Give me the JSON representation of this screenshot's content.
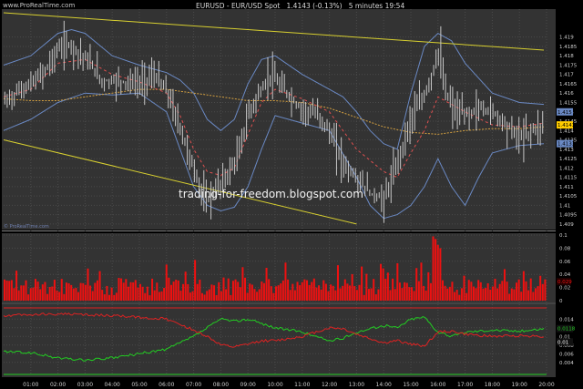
{
  "header": {
    "brand": "www.ProRealTime.com",
    "symbol": "EURUSD - EUR/USD Spot",
    "price": "1.4143 (-0.13%)",
    "timeframe": "5 minutes",
    "time": "19:54"
  },
  "watermark": "trading-for-freedom.blogspot.com",
  "panel_logo": "© ProRealTime.com",
  "colors": {
    "background": "#000000",
    "panel": "#333333",
    "candles": "#c8c8c8",
    "bollinger": "#6a89c4",
    "ma_short": "#e05050",
    "ma_long": "#d4a040",
    "trendline": "#d8d030",
    "volume_bars": "#ee1111",
    "ind_green": "#22cc22",
    "ind_red": "#dd2222"
  },
  "chart_data": [
    {
      "type": "line",
      "title": "EURUSD - EUR/USD Spot",
      "ylim": [
        1.4088,
        1.4203
      ],
      "yticks": [
        "1.419",
        "1.4185",
        "1.418",
        "1.4175",
        "1.417",
        "1.4165",
        "1.416",
        "1.4155",
        "1.415",
        "1.4145",
        "1.414",
        "1.4135",
        "1.413",
        "1.4125",
        "1.412",
        "1.4115",
        "1.411",
        "1.4105",
        "1.41",
        "1.4095",
        "1.409"
      ],
      "xticks": [
        "01:00",
        "02:00",
        "03:00",
        "04:00",
        "05:00",
        "06:00",
        "07:00",
        "08:00",
        "09:00",
        "10:00",
        "11:00",
        "12:00",
        "13:00",
        "14:00",
        "15:00",
        "16:00",
        "17:00",
        "18:00",
        "19:00",
        "20:00"
      ],
      "xlim": [
        0.0,
        20.0
      ],
      "last_price": "1.4143",
      "price_markers": [
        "1.4143",
        "1.415",
        "1.4133"
      ],
      "series": [
        {
          "values": [
            [
              0.0,
              1.4155
            ],
            [
              0.5,
              1.4161
            ],
            [
              1.0,
              1.4165
            ],
            [
              1.5,
              1.4172
            ],
            [
              2.0,
              1.4184
            ],
            [
              2.4,
              1.4186
            ],
            [
              2.8,
              1.4181
            ],
            [
              3.2,
              1.4175
            ],
            [
              3.6,
              1.4166
            ],
            [
              4.0,
              1.4167
            ],
            [
              4.5,
              1.4166
            ],
            [
              5.0,
              1.4165
            ],
            [
              5.5,
              1.417
            ],
            [
              6.0,
              1.416
            ],
            [
              6.5,
              1.414
            ],
            [
              7.0,
              1.4118
            ],
            [
              7.4,
              1.4101
            ],
            [
              7.8,
              1.4109
            ],
            [
              8.2,
              1.4116
            ],
            [
              8.6,
              1.4126
            ],
            [
              9.0,
              1.415
            ],
            [
              9.4,
              1.416
            ],
            [
              9.8,
              1.417
            ],
            [
              10.0,
              1.4166
            ],
            [
              10.4,
              1.416
            ],
            [
              10.8,
              1.4153
            ],
            [
              11.2,
              1.415
            ],
            [
              11.6,
              1.4148
            ],
            [
              12.0,
              1.4138
            ],
            [
              12.5,
              1.4122
            ],
            [
              13.0,
              1.4114
            ],
            [
              13.5,
              1.4106
            ],
            [
              14.0,
              1.4103
            ],
            [
              14.5,
              1.4124
            ],
            [
              15.0,
              1.4148
            ],
            [
              15.4,
              1.4156
            ],
            [
              15.8,
              1.4172
            ],
            [
              16.0,
              1.4185
            ],
            [
              16.2,
              1.4162
            ],
            [
              16.6,
              1.415
            ],
            [
              17.0,
              1.4148
            ],
            [
              17.5,
              1.4152
            ],
            [
              18.0,
              1.415
            ],
            [
              18.5,
              1.4143
            ],
            [
              19.0,
              1.4136
            ],
            [
              19.5,
              1.4141
            ],
            [
              19.9,
              1.4143
            ]
          ]
        },
        {
          "values": [
            [
              0.0,
              1.4175
            ],
            [
              1.0,
              1.418
            ],
            [
              2.0,
              1.4192
            ],
            [
              2.5,
              1.4194
            ],
            [
              3.0,
              1.4192
            ],
            [
              4.0,
              1.418
            ],
            [
              5.0,
              1.4175
            ],
            [
              6.0,
              1.4171
            ],
            [
              6.5,
              1.4167
            ],
            [
              7.0,
              1.416
            ],
            [
              7.5,
              1.4146
            ],
            [
              8.0,
              1.414
            ],
            [
              8.5,
              1.4146
            ],
            [
              9.0,
              1.4165
            ],
            [
              9.5,
              1.4178
            ],
            [
              10.0,
              1.418
            ],
            [
              11.0,
              1.417
            ],
            [
              12.0,
              1.4162
            ],
            [
              12.5,
              1.4158
            ],
            [
              13.0,
              1.415
            ],
            [
              13.5,
              1.414
            ],
            [
              14.0,
              1.4133
            ],
            [
              14.5,
              1.413
            ],
            [
              15.0,
              1.416
            ],
            [
              15.5,
              1.4185
            ],
            [
              16.0,
              1.4192
            ],
            [
              16.5,
              1.4188
            ],
            [
              17.0,
              1.4176
            ],
            [
              18.0,
              1.416
            ],
            [
              19.0,
              1.4155
            ],
            [
              19.9,
              1.4154
            ]
          ]
        },
        {
          "values": [
            [
              0.0,
              1.414
            ],
            [
              1.0,
              1.4146
            ],
            [
              2.0,
              1.4155
            ],
            [
              3.0,
              1.416
            ],
            [
              4.0,
              1.4159
            ],
            [
              5.0,
              1.416
            ],
            [
              6.0,
              1.415
            ],
            [
              6.5,
              1.413
            ],
            [
              7.0,
              1.411
            ],
            [
              7.5,
              1.41
            ],
            [
              8.0,
              1.4097
            ],
            [
              8.5,
              1.4099
            ],
            [
              9.0,
              1.411
            ],
            [
              9.5,
              1.413
            ],
            [
              10.0,
              1.4148
            ],
            [
              11.0,
              1.4144
            ],
            [
              12.0,
              1.414
            ],
            [
              13.0,
              1.4115
            ],
            [
              13.5,
              1.41
            ],
            [
              14.0,
              1.4093
            ],
            [
              14.5,
              1.4095
            ],
            [
              15.0,
              1.41
            ],
            [
              15.5,
              1.411
            ],
            [
              16.0,
              1.4125
            ],
            [
              16.5,
              1.411
            ],
            [
              17.0,
              1.41
            ],
            [
              17.5,
              1.4115
            ],
            [
              18.0,
              1.4128
            ],
            [
              19.0,
              1.4132
            ],
            [
              19.9,
              1.4133
            ]
          ]
        },
        {
          "values": [
            [
              0.0,
              1.4158
            ],
            [
              1.0,
              1.4162
            ],
            [
              2.0,
              1.4176
            ],
            [
              3.0,
              1.4178
            ],
            [
              4.0,
              1.417
            ],
            [
              5.0,
              1.4166
            ],
            [
              6.0,
              1.416
            ],
            [
              6.5,
              1.4148
            ],
            [
              7.0,
              1.413
            ],
            [
              7.5,
              1.4118
            ],
            [
              8.0,
              1.4116
            ],
            [
              8.5,
              1.412
            ],
            [
              9.0,
              1.4138
            ],
            [
              9.5,
              1.4155
            ],
            [
              10.0,
              1.4162
            ],
            [
              11.0,
              1.4157
            ],
            [
              12.0,
              1.415
            ],
            [
              13.0,
              1.413
            ],
            [
              14.0,
              1.4118
            ],
            [
              14.5,
              1.4115
            ],
            [
              15.0,
              1.4128
            ],
            [
              15.5,
              1.414
            ],
            [
              16.0,
              1.4158
            ],
            [
              17.0,
              1.415
            ],
            [
              18.0,
              1.4143
            ],
            [
              19.0,
              1.4142
            ],
            [
              19.9,
              1.4144
            ]
          ]
        },
        {
          "values": [
            [
              0.0,
              1.4157
            ],
            [
              1.0,
              1.4156
            ],
            [
              2.0,
              1.4156
            ],
            [
              3.0,
              1.4158
            ],
            [
              4.0,
              1.416
            ],
            [
              5.0,
              1.4162
            ],
            [
              6.0,
              1.4162
            ],
            [
              7.0,
              1.416
            ],
            [
              8.0,
              1.4158
            ],
            [
              9.0,
              1.4156
            ],
            [
              10.0,
              1.4156
            ],
            [
              11.0,
              1.4155
            ],
            [
              12.0,
              1.4152
            ],
            [
              13.0,
              1.4147
            ],
            [
              14.0,
              1.4142
            ],
            [
              15.0,
              1.4139
            ],
            [
              16.0,
              1.4138
            ],
            [
              17.0,
              1.414
            ],
            [
              18.0,
              1.4141
            ],
            [
              19.0,
              1.4141
            ],
            [
              19.9,
              1.4142
            ]
          ]
        },
        {
          "values": [
            [
              0.0,
              1.4203
            ],
            [
              19.9,
              1.4183
            ]
          ]
        },
        {
          "values": [
            [
              0.0,
              1.4135
            ],
            [
              13.0,
              1.409
            ]
          ]
        }
      ]
    },
    {
      "type": "bar",
      "ylim": [
        0,
        0.1
      ],
      "yticks": [
        "0.1",
        "0.08",
        "0.06",
        "0.04",
        "0.02",
        "0"
      ],
      "last_value": "0.029",
      "seed": 7,
      "bars": 228,
      "peaks": [
        [
          180,
          0.098
        ],
        [
          181,
          0.094
        ],
        [
          182,
          0.085
        ],
        [
          183,
          0.08
        ],
        [
          80,
          0.062
        ],
        [
          68,
          0.055
        ],
        [
          118,
          0.058
        ],
        [
          140,
          0.054
        ],
        [
          150,
          0.052
        ],
        [
          158,
          0.056
        ],
        [
          165,
          0.057
        ],
        [
          175,
          0.058
        ],
        [
          210,
          0.048
        ],
        [
          40,
          0.045
        ],
        [
          110,
          0.05
        ],
        [
          100,
          0.051
        ]
      ]
    },
    {
      "type": "line",
      "ylim": [
        0.001,
        0.017
      ],
      "yticks": [
        "0.014",
        "0.012",
        "0.01",
        "0.008",
        "0.006",
        "0.004"
      ],
      "last_values": [
        "0.0118",
        "0.01"
      ],
      "series": [
        {
          "color": "green",
          "values": [
            [
              0.0,
              0.0065
            ],
            [
              1.0,
              0.0062
            ],
            [
              2.0,
              0.005
            ],
            [
              3.0,
              0.0045
            ],
            [
              4.0,
              0.005
            ],
            [
              5.0,
              0.006
            ],
            [
              6.0,
              0.007
            ],
            [
              7.0,
              0.01
            ],
            [
              7.5,
              0.012
            ],
            [
              8.0,
              0.014
            ],
            [
              8.5,
              0.0135
            ],
            [
              9.0,
              0.014
            ],
            [
              9.5,
              0.013
            ],
            [
              10.0,
              0.012
            ],
            [
              11.0,
              0.011
            ],
            [
              12.0,
              0.009
            ],
            [
              12.5,
              0.0095
            ],
            [
              13.0,
              0.011
            ],
            [
              14.0,
              0.0125
            ],
            [
              14.5,
              0.012
            ],
            [
              15.0,
              0.014
            ],
            [
              15.5,
              0.0145
            ],
            [
              16.0,
              0.011
            ],
            [
              16.5,
              0.01
            ],
            [
              17.0,
              0.011
            ],
            [
              18.0,
              0.0115
            ],
            [
              19.0,
              0.0112
            ],
            [
              19.9,
              0.0118
            ]
          ]
        },
        {
          "color": "red",
          "values": [
            [
              0.0,
              0.0148
            ],
            [
              1.0,
              0.015
            ],
            [
              2.0,
              0.0152
            ],
            [
              3.0,
              0.015
            ],
            [
              4.0,
              0.0148
            ],
            [
              5.0,
              0.0144
            ],
            [
              6.0,
              0.014
            ],
            [
              7.0,
              0.0115
            ],
            [
              7.5,
              0.01
            ],
            [
              8.0,
              0.008
            ],
            [
              8.5,
              0.0075
            ],
            [
              9.0,
              0.0082
            ],
            [
              9.5,
              0.009
            ],
            [
              10.0,
              0.009
            ],
            [
              11.0,
              0.01
            ],
            [
              12.0,
              0.012
            ],
            [
              12.5,
              0.0118
            ],
            [
              13.0,
              0.0105
            ],
            [
              14.0,
              0.0085
            ],
            [
              14.5,
              0.009
            ],
            [
              15.0,
              0.0082
            ],
            [
              15.5,
              0.0078
            ],
            [
              16.0,
              0.011
            ],
            [
              16.5,
              0.0112
            ],
            [
              17.0,
              0.0105
            ],
            [
              18.0,
              0.01
            ],
            [
              19.0,
              0.0102
            ],
            [
              19.9,
              0.01
            ]
          ]
        }
      ]
    }
  ]
}
